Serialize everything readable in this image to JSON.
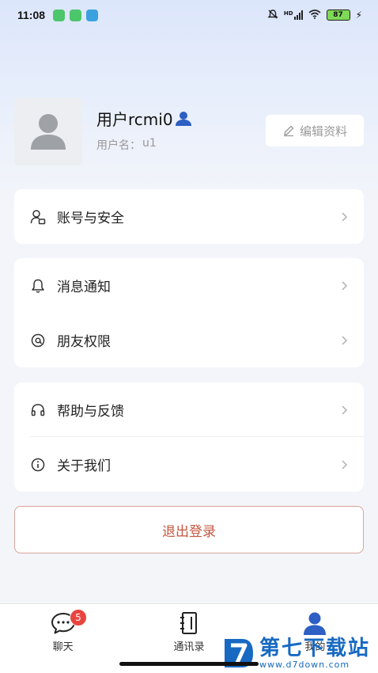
{
  "status": {
    "time": "11:08",
    "battery": "87",
    "hd_label": "HD"
  },
  "profile": {
    "nickname": "用户rcmi0",
    "username_label": "用户名：",
    "username": "u1",
    "edit_label": "编辑资料"
  },
  "menu": {
    "account_security": "账号与安全",
    "notifications": "消息通知",
    "friend_permissions": "朋友权限",
    "help_feedback": "帮助与反馈",
    "about_us": "关于我们"
  },
  "logout_label": "退出登录",
  "tabbar": {
    "chat": "聊天",
    "chat_badge": "5",
    "contacts": "通讯录",
    "me": "我的"
  },
  "watermark": {
    "title": "第七下载站",
    "url": "www.d7down.com"
  },
  "colors": {
    "accent_blue": "#2d5fc4",
    "logout_red": "#c5563f",
    "badge_red": "#e9453f"
  }
}
